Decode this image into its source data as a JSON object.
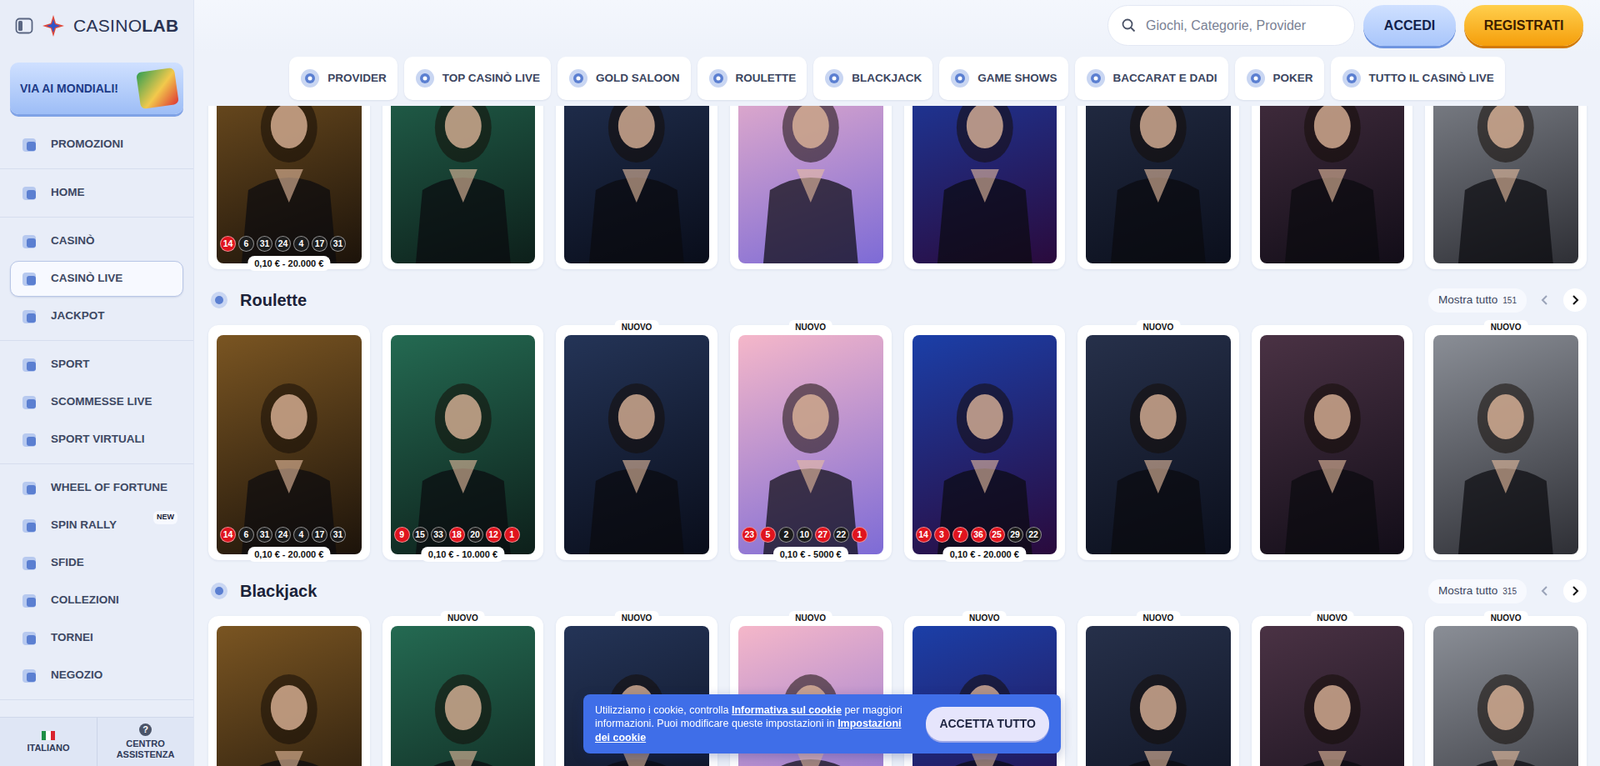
{
  "logo": {
    "prefix": "CASINO",
    "suffix": "LAB"
  },
  "search": {
    "placeholder": "Giochi, Categorie, Provider"
  },
  "auth": {
    "login": "ACCEDI",
    "register": "REGISTRATI"
  },
  "sidebar": {
    "promo": "VIA AI MONDIALI!",
    "groups": [
      {
        "items": [
          {
            "label": "PROMOZIONI",
            "selected": false
          }
        ]
      },
      {
        "items": [
          {
            "label": "HOME",
            "selected": false
          }
        ]
      },
      {
        "items": [
          {
            "label": "CASINÒ",
            "selected": false
          },
          {
            "label": "CASINÒ LIVE",
            "selected": true
          },
          {
            "label": "JACKPOT",
            "selected": false
          }
        ]
      },
      {
        "items": [
          {
            "label": "SPORT",
            "selected": false
          },
          {
            "label": "SCOMMESSE LIVE",
            "selected": false
          },
          {
            "label": "SPORT VIRTUALI",
            "selected": false
          }
        ]
      },
      {
        "items": [
          {
            "label": "WHEEL OF FORTUNE",
            "selected": false
          },
          {
            "label": "SPIN RALLY",
            "selected": false,
            "badge": "NEW"
          },
          {
            "label": "SFIDE",
            "selected": false
          },
          {
            "label": "COLLEZIONI",
            "selected": false
          },
          {
            "label": "TORNEI",
            "selected": false
          },
          {
            "label": "NEGOZIO",
            "selected": false
          }
        ]
      }
    ],
    "footer": [
      {
        "label": "ITALIANO",
        "kind": "flag"
      },
      {
        "label": "CENTRO ASSISTENZA",
        "kind": "help",
        "icon": "?"
      }
    ]
  },
  "tabs": [
    {
      "label": "PROVIDER",
      "selected": false
    },
    {
      "label": "TOP CASINÒ LIVE",
      "selected": false
    },
    {
      "label": "GOLD SALOON",
      "selected": false
    },
    {
      "label": "ROULETTE",
      "selected": false
    },
    {
      "label": "BLACKJACK",
      "selected": false
    },
    {
      "label": "GAME SHOWS",
      "selected": false
    },
    {
      "label": "BACCARAT E DADI",
      "selected": false
    },
    {
      "label": "POKER",
      "selected": false
    },
    {
      "label": "TUTTO IL CASINÒ LIVE",
      "selected": false
    }
  ],
  "sections": [
    {
      "items": [
        {
          "chips": [
            {
              "n": "14",
              "color": "#e0141e"
            },
            {
              "n": "6",
              "color": "#1c1c1c"
            },
            {
              "n": "31",
              "color": "#1c1c1c"
            },
            {
              "n": "24",
              "color": "#1c1c1c"
            },
            {
              "n": "4",
              "color": "#1c1c1c"
            },
            {
              "n": "17",
              "color": "#1c1c1c"
            },
            {
              "n": "31",
              "color": "#1c1c1c"
            }
          ],
          "range": "0,10 € - 20.000 €"
        },
        {
          "chips": []
        },
        {
          "chips": []
        },
        {
          "chips": []
        },
        {
          "chips": []
        },
        {
          "chips": []
        },
        {
          "chips": []
        },
        {
          "chips": []
        }
      ]
    },
    {
      "header": {
        "title": "Roulette",
        "more": "Mostra tutto",
        "count": "151"
      },
      "items": [
        {
          "chips": [
            {
              "n": "14",
              "color": "#e0141e"
            },
            {
              "n": "6",
              "color": "#1c1c1c"
            },
            {
              "n": "31",
              "color": "#1c1c1c"
            },
            {
              "n": "24",
              "color": "#1c1c1c"
            },
            {
              "n": "4",
              "color": "#1c1c1c"
            },
            {
              "n": "17",
              "color": "#1c1c1c"
            },
            {
              "n": "31",
              "color": "#1c1c1c"
            }
          ],
          "range": "0,10 € - 20.000 €"
        },
        {
          "chips": [
            {
              "n": "9",
              "color": "#e0141e"
            },
            {
              "n": "15",
              "color": "#1c1c1c"
            },
            {
              "n": "33",
              "color": "#1c1c1c"
            },
            {
              "n": "18",
              "color": "#e0141e"
            },
            {
              "n": "20",
              "color": "#1c1c1c"
            },
            {
              "n": "12",
              "color": "#e0141e"
            },
            {
              "n": "1",
              "color": "#e0141e"
            }
          ],
          "range": "0,10 € - 10.000 €"
        },
        {
          "badge": "NUOVO",
          "chips": []
        },
        {
          "badge": "NUOVO",
          "chips": [
            {
              "n": "23",
              "color": "#e0141e"
            },
            {
              "n": "5",
              "color": "#e0141e"
            },
            {
              "n": "2",
              "color": "#1c1c1c"
            },
            {
              "n": "10",
              "color": "#1c1c1c"
            },
            {
              "n": "27",
              "color": "#e0141e"
            },
            {
              "n": "22",
              "color": "#1c1c1c"
            },
            {
              "n": "1",
              "color": "#e0141e"
            }
          ],
          "range": "0,10 € - 5000 €"
        },
        {
          "chips": [
            {
              "n": "14",
              "color": "#e0141e"
            },
            {
              "n": "3",
              "color": "#e0141e"
            },
            {
              "n": "7",
              "color": "#e0141e"
            },
            {
              "n": "36",
              "color": "#e0141e"
            },
            {
              "n": "25",
              "color": "#e0141e"
            },
            {
              "n": "29",
              "color": "#1c1c1c"
            },
            {
              "n": "22",
              "color": "#1c1c1c"
            }
          ],
          "range": "0,10 € - 20.000 €"
        },
        {
          "badge": "NUOVO",
          "chips": []
        },
        {
          "chips": []
        },
        {
          "badge": "NUOVO",
          "chips": []
        }
      ]
    },
    {
      "header": {
        "title": "Blackjack",
        "more": "Mostra tutto",
        "count": "315"
      },
      "items": [
        {
          "chips": []
        },
        {
          "badge": "NUOVO",
          "chips": []
        },
        {
          "badge": "NUOVO",
          "chips": []
        },
        {
          "badge": "NUOVO",
          "chips": []
        },
        {
          "badge": "NUOVO",
          "chips": []
        },
        {
          "badge": "NUOVO",
          "chips": []
        },
        {
          "badge": "NUOVO",
          "chips": []
        },
        {
          "badge": "NUOVO",
          "chips": []
        }
      ]
    }
  ],
  "cookie": {
    "text1": "Utilizziamo i cookie, controlla ",
    "link1": "Informativa sul cookie",
    "text2": " per maggiori informazioni. Puoi modificare queste impostazioni in ",
    "link2": "Impostazioni dei cookie",
    "button": "ACCETTA TUTTO"
  }
}
